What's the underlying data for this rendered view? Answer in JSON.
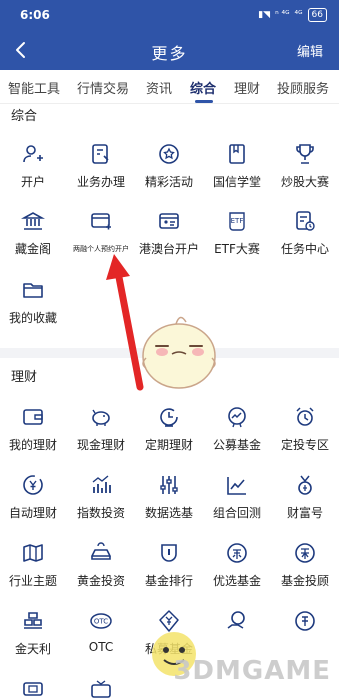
{
  "status": {
    "time": "6:06",
    "signal_left": "ⁿ ⁴ᴳ",
    "signal_right": "⁴ᴳ",
    "battery": "66"
  },
  "header": {
    "title": "更多",
    "edit_label": "编辑"
  },
  "tabs": [
    "智能工具",
    "行情交易",
    "资讯",
    "综合",
    "理财",
    "投顾服务"
  ],
  "active_tab": "综合",
  "sections": {
    "zonghe": {
      "title": "综合",
      "items": [
        {
          "label": "开户",
          "icon": "user-add-icon"
        },
        {
          "label": "业务办理",
          "icon": "document-edit-icon"
        },
        {
          "label": "精彩活动",
          "icon": "activity-badge-icon"
        },
        {
          "label": "国信学堂",
          "icon": "book-icon"
        },
        {
          "label": "炒股大赛",
          "icon": "trophy-icon"
        },
        {
          "label": "藏金阁",
          "icon": "bank-icon"
        },
        {
          "label": "两融个人预约开户",
          "icon": "card-add-icon"
        },
        {
          "label": "港澳台开户",
          "icon": "id-card-icon"
        },
        {
          "label": "ETF大赛",
          "icon": "etf-icon"
        },
        {
          "label": "任务中心",
          "icon": "task-clock-icon"
        },
        {
          "label": "我的收藏",
          "icon": "folder-icon"
        }
      ]
    },
    "licai": {
      "title": "理财",
      "items": [
        {
          "label": "我的理财",
          "icon": "wallet-icon"
        },
        {
          "label": "现金理财",
          "icon": "piggy-bank-icon"
        },
        {
          "label": "定期理财",
          "icon": "timer-icon"
        },
        {
          "label": "公募基金",
          "icon": "chart-badge-icon"
        },
        {
          "label": "定投专区",
          "icon": "alarm-icon"
        },
        {
          "label": "自动理财",
          "icon": "yen-coin-icon"
        },
        {
          "label": "指数投资",
          "icon": "bar-chart-icon"
        },
        {
          "label": "数据选基",
          "icon": "sliders-icon"
        },
        {
          "label": "组合回测",
          "icon": "line-chart-icon"
        },
        {
          "label": "财富号",
          "icon": "medal-icon"
        },
        {
          "label": "行业主题",
          "icon": "map-icon"
        },
        {
          "label": "黄金投资",
          "icon": "gold-bar-icon"
        },
        {
          "label": "基金排行",
          "icon": "rank-shield-icon"
        },
        {
          "label": "优选基金",
          "icon": "select-fund-icon"
        },
        {
          "label": "基金投顾",
          "icon": "fund-advisor-icon"
        },
        {
          "label": "金天利",
          "icon": "gold-stack-icon"
        },
        {
          "label": "OTC",
          "icon": "otc-icon"
        },
        {
          "label": "私募基金",
          "icon": "diamond-yen-icon"
        },
        {
          "label": "",
          "icon": "coin-hand-icon"
        },
        {
          "label": "",
          "icon": "money-icon"
        }
      ]
    }
  },
  "watermark": "3DMGAME",
  "colors": {
    "header": "#2f54a8",
    "icon": "#1e3a7e",
    "divider": "#f2f3f6",
    "arrow": "#e32626"
  }
}
